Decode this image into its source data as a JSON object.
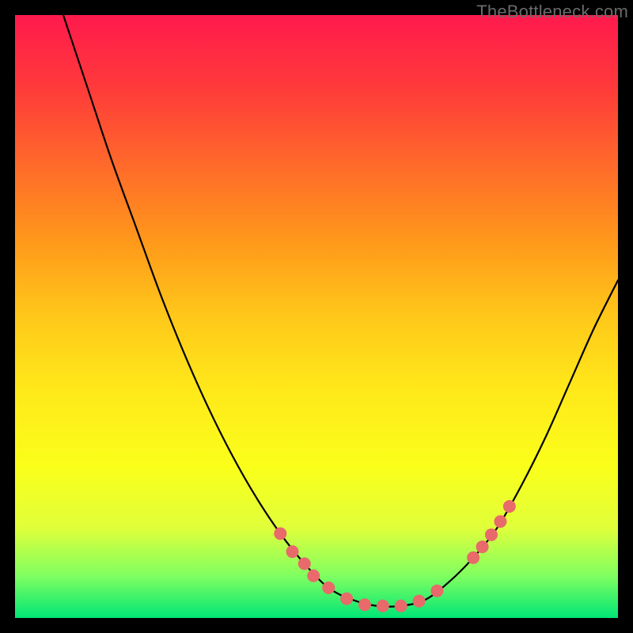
{
  "watermark": "TheBottleneck.com",
  "chart_data": {
    "type": "line",
    "title": "",
    "xlabel": "",
    "ylabel": "",
    "xlim": [
      0,
      100
    ],
    "ylim": [
      0,
      100
    ],
    "curve": {
      "name": "bottleneck-curve",
      "points": [
        {
          "x": 8.0,
          "y": 100.0
        },
        {
          "x": 12.0,
          "y": 88.0
        },
        {
          "x": 16.0,
          "y": 76.0
        },
        {
          "x": 20.0,
          "y": 65.0
        },
        {
          "x": 24.0,
          "y": 54.0
        },
        {
          "x": 28.0,
          "y": 44.0
        },
        {
          "x": 32.0,
          "y": 35.0
        },
        {
          "x": 36.0,
          "y": 27.0
        },
        {
          "x": 40.0,
          "y": 20.0
        },
        {
          "x": 44.0,
          "y": 14.0
        },
        {
          "x": 48.0,
          "y": 9.0
        },
        {
          "x": 52.0,
          "y": 5.0
        },
        {
          "x": 56.0,
          "y": 3.0
        },
        {
          "x": 60.0,
          "y": 2.0
        },
        {
          "x": 64.0,
          "y": 2.0
        },
        {
          "x": 68.0,
          "y": 3.0
        },
        {
          "x": 72.0,
          "y": 6.0
        },
        {
          "x": 76.0,
          "y": 10.0
        },
        {
          "x": 80.0,
          "y": 15.0
        },
        {
          "x": 84.0,
          "y": 22.0
        },
        {
          "x": 88.0,
          "y": 30.0
        },
        {
          "x": 92.0,
          "y": 39.0
        },
        {
          "x": 96.0,
          "y": 48.0
        },
        {
          "x": 100.0,
          "y": 56.0
        }
      ]
    },
    "markers": {
      "color": "#e86a6a",
      "radius": 8,
      "points": [
        {
          "x": 44.0,
          "y": 14.0
        },
        {
          "x": 46.0,
          "y": 11.0
        },
        {
          "x": 48.0,
          "y": 9.0
        },
        {
          "x": 49.5,
          "y": 7.0
        },
        {
          "x": 52.0,
          "y": 5.0
        },
        {
          "x": 55.0,
          "y": 3.2
        },
        {
          "x": 58.0,
          "y": 2.2
        },
        {
          "x": 61.0,
          "y": 2.0
        },
        {
          "x": 64.0,
          "y": 2.0
        },
        {
          "x": 67.0,
          "y": 2.8
        },
        {
          "x": 70.0,
          "y": 4.5
        },
        {
          "x": 76.0,
          "y": 10.0
        },
        {
          "x": 77.5,
          "y": 11.8
        },
        {
          "x": 79.0,
          "y": 13.8
        },
        {
          "x": 80.5,
          "y": 16.0
        },
        {
          "x": 82.0,
          "y": 18.5
        }
      ]
    },
    "green_band": {
      "y": 2.0,
      "height": 4.0,
      "color": "#00d97a"
    }
  }
}
